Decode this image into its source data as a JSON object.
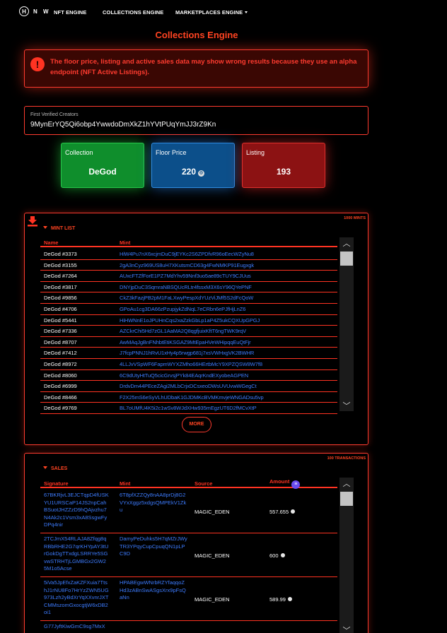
{
  "nav": {
    "logo_letters": "HNW",
    "logo_badge": "H",
    "logo_text": "N W",
    "items": [
      "NFT ENGINE",
      "COLLECTIONS ENGINE",
      "MARKETPLACES ENGINE"
    ]
  },
  "page_title": "Collections Engine",
  "alert": {
    "icon": "!",
    "text": "The floor price, listing and active sales data may show wrong results because they use an alpha endpoint (NFT Active Listings)."
  },
  "creator": {
    "label": "First Verified Creators",
    "value": "9MynErYQ5Qi6obp4YwwdoDmXkZ1hYVtPUqYmJJ3rZ9Kn"
  },
  "cards": {
    "collection": {
      "label": "Collection",
      "value": "DeGod"
    },
    "floor": {
      "label": "Floor Price",
      "value": "220"
    },
    "listing": {
      "label": "Listing",
      "value": "193"
    }
  },
  "mint_panel": {
    "count": "1000 MINTS",
    "section": "MINT LIST",
    "headers": {
      "name": "Name",
      "mint": "Mint"
    },
    "rows": [
      {
        "name": "DeGod #3373",
        "mint": "HiW4Pu7nX6xcjmDuC9jEYKc2S6ZPDfvR96oEecWZyNu8"
      },
      {
        "name": "DeGod #3155",
        "mint": "2gA3nCyz969US8uH7XKutsmCD63g4FwNMKP91Eugxgk"
      },
      {
        "name": "DeGod #7264",
        "mint": "AUxcFTZfForE1PZ7MdYhv59Nnf3uo5ae89cTUY9CJUus"
      },
      {
        "name": "DeGod #3817",
        "mint": "DNYjpDuC3SqmraNBSQUcRLtr4fssxM3X6sY96QYePNF"
      },
      {
        "name": "DeGod #9856",
        "mint": "CkZ3kFazjPB2pM1FaLXwyPespXdYUzViJMf5S2dFcQoW"
      },
      {
        "name": "DeGod #4706",
        "mint": "GPoAu1cg3DA66zPzupjykZdNqL7eCRbn6ePJfHjLnZ6"
      },
      {
        "name": "DeGod #5441",
        "mint": "HiHWNnE1oJPUHnCqs2xaZzkGbLp1aP4Z5ukCQXUpGPGJ"
      },
      {
        "name": "DeGod #7336",
        "mint": "AZCkrChi5Hd7zGL1AaMA2Q8qgfjuixKftT6ngTWK9rqV"
      },
      {
        "name": "DeGod #8707",
        "mint": "AwMAqJgBnFNhbtEtiKSGAZ9MtEpaHVeWHipqqEuQtFjr"
      },
      {
        "name": "DeGod #7412",
        "mint": "J7fcpPNNJ1hRvU1xHy4p5rwgp681j7xsVWHxgVK2BWHR"
      },
      {
        "name": "DeGod #8972",
        "mint": "4LLJvVSpWF6FapmWYXZMho66HErtbMcY9XPZQSW8W7f8"
      },
      {
        "name": "DeGod #8060",
        "mint": "6C9dUtyHtTuQ5cicGrvsjPYk84EAqrKndEXyobeAGPEN"
      },
      {
        "name": "DeGod #6999",
        "mint": "DrdvDm44PEceZAgi2MLbCrjxDCsxeoDWsUVUvwWGegCt"
      },
      {
        "name": "DeGod #8466",
        "mint": "F2X25mS6eSyVLhUDbaK1GJDMKcBVMKmvjeWNGADsu5vp"
      },
      {
        "name": "DeGod #9769",
        "mint": "BL7oUMfU4K5i2c1wSv8WJdXHw935mEgzUT6D2fMCvXtP"
      }
    ],
    "more_label": "MORE"
  },
  "sales_panel": {
    "count": "100 TRANSACTIONS",
    "section": "SALES",
    "headers": {
      "signature": "Signature",
      "mint": "Mint",
      "source": "Source",
      "amount": "Amount"
    },
    "rows": [
      {
        "signature": "67BKRjvL3EJCTqpD4fUSKYU1URSCaP14JS2npCahBSuotJHZZzD9hQAjvzhu7N4Ak2c1Vsm3xA8SsgwFyDPq4nir",
        "mint": "6T8pfXZZQy8nAA8prDj8G2VYxXggz5xdgsQMPEkV1Zku",
        "source": "MAGIC_EDEN",
        "amount": "557.655"
      },
      {
        "signature": "2TCJmX54RLAJA8Zfqg8qRBbRHE2G7qrKHYpAY3tUrGokDgTTxdgLSRRYe5SGvwSTRHTjLGMBGx2GW25M1o5Acse",
        "mint": "DamyPeDuhks5H7qMZrJWyTR3YPqyCupCpuqQN1pLPC9D",
        "source": "MAGIC_EDEN",
        "amount": "600"
      },
      {
        "signature": "5iVa5JpEfxZaKZFXuia7TtshJ1rNU8Fo7HrYzZWN5UG973Lzh2yBdXrYqXXvnrJXTCMMszomGxocgtjW6xDB2oi1",
        "mint": "HPABEgwWNrbRZYfaqqoZHd3zABnSwASgsXrx9pFsQaNn",
        "source": "MAGIC_EDEN",
        "amount": "589.99"
      },
      {
        "signature": "G77JyftKiwGmC9sg7MxX",
        "mint": "",
        "source": "",
        "amount": ""
      }
    ]
  }
}
